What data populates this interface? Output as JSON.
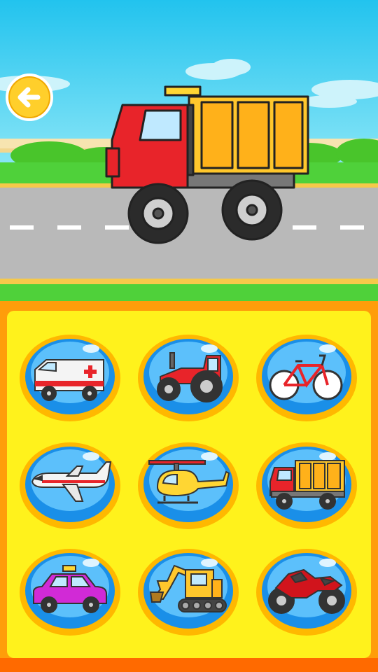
{
  "screen": "vehicle-picker",
  "header": {
    "back_icon": "arrow-left-icon",
    "featured_vehicle": "dump-truck"
  },
  "colors": {
    "sky": "#2fc9ef",
    "grass": "#4fd13a",
    "road": "#b9b9b9",
    "panel_fill": "#fff21c",
    "panel_border": "#ff9d0a",
    "button_ring": "#ffb800",
    "button_blue": "#1a8fe8"
  },
  "vehicles": [
    {
      "id": "ambulance",
      "icon": "ambulance-icon"
    },
    {
      "id": "tractor",
      "icon": "tractor-icon"
    },
    {
      "id": "bicycle",
      "icon": "bicycle-icon"
    },
    {
      "id": "airplane",
      "icon": "airplane-icon"
    },
    {
      "id": "helicopter",
      "icon": "helicopter-icon"
    },
    {
      "id": "dump-truck",
      "icon": "dump-truck-icon"
    },
    {
      "id": "taxi",
      "icon": "taxi-icon"
    },
    {
      "id": "excavator",
      "icon": "excavator-icon"
    },
    {
      "id": "motorcycle",
      "icon": "motorcycle-icon"
    }
  ]
}
